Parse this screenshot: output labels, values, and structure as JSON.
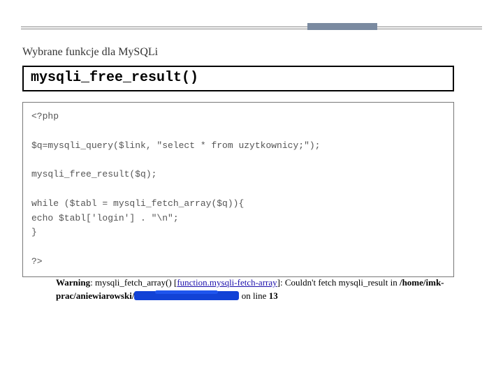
{
  "subtitle": "Wybrane funkcje dla MySQLi",
  "function_name": "mysqli_free_result()",
  "code": "<?php\n\n$q=mysqli_query($link, \"select * from uzytkownicy;\");\n\nmysqli_free_result($q);\n\nwhile ($tabl = mysqli_fetch_array($q)){\necho $tabl['login'] . \"\\n\";\n}\n\n?>",
  "warning": {
    "label": "Warning",
    "func": "mysqli_fetch_array()",
    "link_text": "function.mysqli-fetch-array",
    "msg_before_path": ": Couldn't fetch mysqli_result in ",
    "path_prefix": "/home/imk-prac/aniewiarowski/",
    "msg_after_path": " on line ",
    "line": "13"
  }
}
